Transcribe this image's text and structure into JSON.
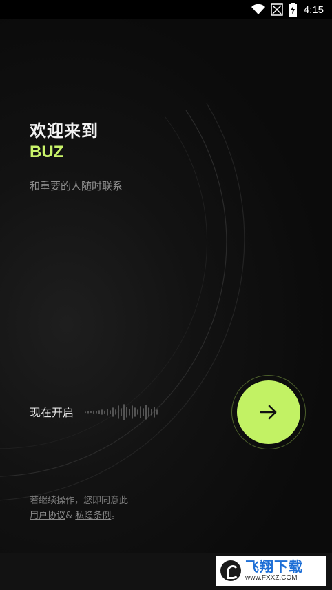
{
  "status_bar": {
    "time": "4:15",
    "icons": [
      "wifi-icon",
      "signal-off-icon",
      "battery-charging-icon"
    ]
  },
  "welcome": {
    "line1": "欢迎来到",
    "brand": "BUZ",
    "tagline": "和重要的人随时联系"
  },
  "start": {
    "label": "现在开启",
    "next_icon": "arrow-right-icon"
  },
  "terms": {
    "prefix": "若继续操作，您即同意此",
    "user_agreement": "用户协议",
    "amp": "& ",
    "privacy": "私隐条例",
    "suffix": "。"
  },
  "watermark": {
    "title": "飞翔下载",
    "url": "www.FXXZ.COM"
  },
  "colors": {
    "accent": "#c2f264",
    "brand_text": "#c9f36a",
    "background": "#0b0b0b"
  }
}
